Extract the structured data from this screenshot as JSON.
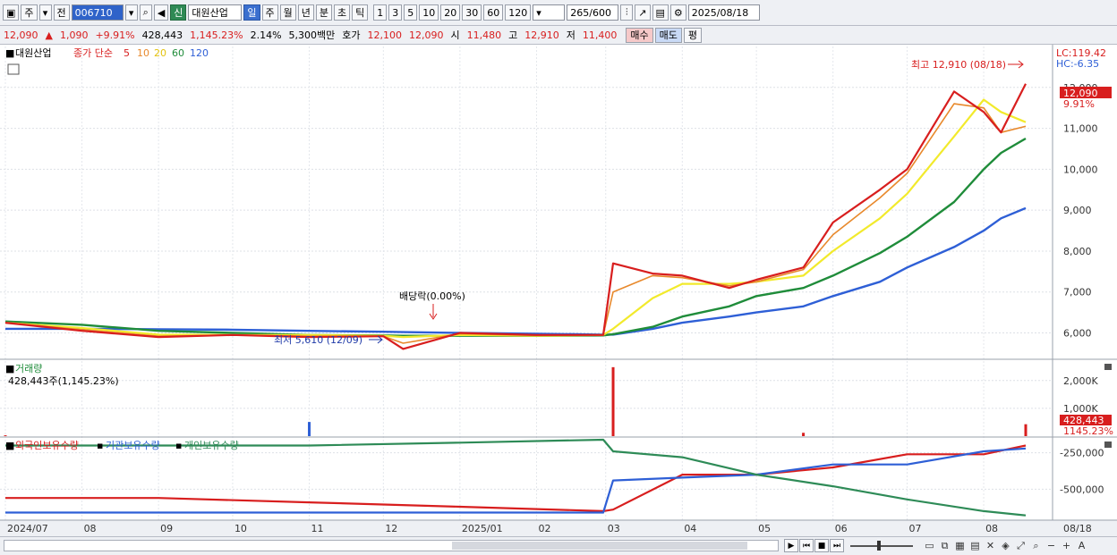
{
  "toolbar": {
    "market": "주",
    "prev": "전",
    "code": "006710",
    "name_badge": "신",
    "name": "대원산업",
    "periods": [
      "일",
      "주",
      "월",
      "년",
      "분",
      "초",
      "틱"
    ],
    "active_period": "일",
    "intervals": [
      "1",
      "3",
      "5",
      "10",
      "20",
      "30",
      "60",
      "120"
    ],
    "count": "265",
    "count_max": "/600",
    "date": "2025/08/18"
  },
  "quote": {
    "price": "12,090",
    "change": "1,090",
    "change_pct": "+9.91%",
    "volume": "428,443",
    "volume_ratio": "1,145.23%",
    "turnover": "2.14%",
    "amount": "5,300백만",
    "hoga_label": "호가",
    "ask": "12,100",
    "bid": "12,090",
    "open_label": "시",
    "open": "11,480",
    "high_label": "고",
    "high": "12,910",
    "low_label": "저",
    "low": "11,400",
    "buy": "매수",
    "sell": "매도",
    "avg": "평"
  },
  "colors": {
    "price_line": "#d81e1e",
    "ma5": "#e8892c",
    "ma20": "#f2ea2c",
    "ma60": "#1f8c3a",
    "ma120": "#2e5fd6",
    "foreign": "#d81e1e",
    "institution": "#2e5fd6",
    "individual": "#2e8b57"
  },
  "chart_data": [
    {
      "type": "line",
      "title": "대원산업",
      "legend": {
        "type_label": "종가 단순",
        "periods": [
          "5",
          "10",
          "20",
          "60",
          "120"
        ]
      },
      "x": [
        "2024-07-01",
        "2024-08-01",
        "2024-09-01",
        "2024-10-01",
        "2024-11-01",
        "2024-12-01",
        "2024-12-09",
        "2025-01-01",
        "2025-02-01",
        "2025-02-28",
        "2025-03-04",
        "2025-03-20",
        "2025-04-01",
        "2025-04-20",
        "2025-05-01",
        "2025-05-20",
        "2025-06-01",
        "2025-06-20",
        "2025-07-01",
        "2025-07-20",
        "2025-08-01",
        "2025-08-08",
        "2025-08-18"
      ],
      "series": [
        {
          "name": "종가",
          "values": [
            6250,
            6050,
            5900,
            5950,
            5900,
            5920,
            5610,
            6000,
            5950,
            5950,
            7700,
            7450,
            7400,
            7100,
            7300,
            7600,
            8700,
            9500,
            10000,
            11900,
            11400,
            10900,
            12090
          ]
        },
        {
          "name": "5",
          "values": [
            6250,
            6080,
            5920,
            5950,
            5920,
            5920,
            5750,
            5980,
            5940,
            5950,
            7000,
            7400,
            7350,
            7150,
            7250,
            7550,
            8400,
            9300,
            9900,
            11600,
            11500,
            10900,
            11050
          ]
        },
        {
          "name": "20",
          "values": [
            6250,
            6120,
            5960,
            5950,
            5950,
            5930,
            5900,
            5950,
            5930,
            5950,
            6100,
            6850,
            7200,
            7200,
            7250,
            7400,
            8000,
            8800,
            9400,
            10800,
            11700,
            11400,
            11150
          ]
        },
        {
          "name": "60",
          "values": [
            6280,
            6200,
            6050,
            6000,
            5950,
            5940,
            5930,
            5930,
            5930,
            5940,
            5970,
            6150,
            6400,
            6650,
            6900,
            7100,
            7400,
            7950,
            8350,
            9200,
            10000,
            10400,
            10750
          ]
        },
        {
          "name": "120",
          "values": [
            6100,
            6100,
            6090,
            6080,
            6050,
            6030,
            6020,
            6000,
            5980,
            5960,
            5960,
            6100,
            6250,
            6400,
            6500,
            6650,
            6900,
            7250,
            7600,
            8100,
            8500,
            8800,
            9050
          ]
        }
      ],
      "ylim": [
        5400,
        13000
      ],
      "y_ticks": [
        "6,000",
        "7,000",
        "8,000",
        "9,000",
        "10,000",
        "11,000",
        "12,000"
      ],
      "annotations": {
        "high": "최고 12,910 (08/18)",
        "low": "최저 5,610 (12/09)",
        "dividend": "배당락(0.00%)",
        "lc": "LC:119.42",
        "hc": "HC:-6.35",
        "last_price": "12,090",
        "last_pct": "9.91%"
      }
    },
    {
      "type": "bar",
      "title": "거래량",
      "subtitle": "428,443주(1,145.23%)",
      "x": [
        "2024-07",
        "2024-11-01",
        "2025-03-04",
        "2025-05-20",
        "2025-08-18"
      ],
      "values": [
        30000,
        510000,
        2480000,
        120000,
        428443
      ],
      "ylim": [
        0,
        2700000
      ],
      "y_ticks": [
        "1,000K",
        "2,000K"
      ],
      "last_value": "428,443",
      "last_pct": "1145.23%"
    },
    {
      "type": "line",
      "legend": [
        "외국인보유수량",
        "기관보유수량",
        "개인보유수량"
      ],
      "x": [
        "2024-07-01",
        "2024-09-01",
        "2024-11-01",
        "2025-01-01",
        "2025-02-28",
        "2025-03-04",
        "2025-04-01",
        "2025-05-01",
        "2025-06-01",
        "2025-07-01",
        "2025-08-01",
        "2025-08-18"
      ],
      "series": [
        {
          "name": "외국인보유수량",
          "values": [
            -560000,
            -560000,
            -590000,
            -620000,
            -650000,
            -640000,
            -400000,
            -400000,
            -350000,
            -260000,
            -260000,
            -200000
          ]
        },
        {
          "name": "기관보유수량",
          "values": [
            -660000,
            -660000,
            -660000,
            -660000,
            -660000,
            -440000,
            -420000,
            -400000,
            -330000,
            -330000,
            -240000,
            -220000
          ]
        },
        {
          "name": "개인보유수량",
          "values": [
            -200000,
            -200000,
            -200000,
            -180000,
            -160000,
            -240000,
            -280000,
            -400000,
            -480000,
            -570000,
            -650000,
            -680000
          ]
        }
      ],
      "ylim": [
        -700000,
        -160000
      ],
      "y_ticks": [
        "-250,000",
        "-500,000"
      ]
    }
  ],
  "xaxis": {
    "labels": [
      "2024/07",
      "08",
      "09",
      "10",
      "11",
      "12",
      "2025/01",
      "02",
      "03",
      "04",
      "05",
      "06",
      "07",
      "08"
    ],
    "last_date": "08/18"
  }
}
